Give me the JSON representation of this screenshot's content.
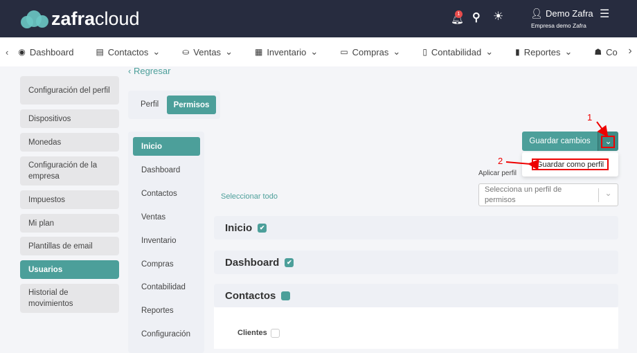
{
  "header": {
    "brand_bold": "zafra",
    "brand_light": "cloud",
    "notification_count": "1",
    "user_name": "Demo Zafra",
    "company": "Empresa demo Zafra"
  },
  "nav": {
    "items": [
      {
        "label": "Dashboard",
        "icon": "dashboard-icon"
      },
      {
        "label": "Contactos",
        "icon": "contact-card-icon",
        "dropdown": true
      },
      {
        "label": "Ventas",
        "icon": "hand-coin-icon",
        "dropdown": true
      },
      {
        "label": "Inventario",
        "icon": "boxes-icon",
        "dropdown": true
      },
      {
        "label": "Compras",
        "icon": "cart-icon",
        "dropdown": true
      },
      {
        "label": "Contabilidad",
        "icon": "calculator-icon",
        "dropdown": true
      },
      {
        "label": "Reportes",
        "icon": "bar-chart-icon",
        "dropdown": true
      },
      {
        "label": "Co",
        "icon": "burger-icon"
      }
    ]
  },
  "back_label": "Regresar",
  "sidebar": {
    "items": [
      "Configuración del perfil",
      "Dispositivos",
      "Monedas",
      "Configuración de la empresa",
      "Impuestos",
      "Mi plan",
      "Plantillas de email",
      "Usuarios",
      "Historial de movimientos"
    ],
    "active": "Usuarios"
  },
  "tabs": {
    "items": [
      "Perfil",
      "Permisos"
    ],
    "active": "Permisos"
  },
  "submenu": {
    "items": [
      "Inicio",
      "Dashboard",
      "Contactos",
      "Ventas",
      "Inventario",
      "Compras",
      "Contabilidad",
      "Reportes",
      "Configuración"
    ],
    "active": "Inicio"
  },
  "main": {
    "select_all": "Seleccionar todo",
    "save_label": "Guardar cambios",
    "dropdown_item": "Guardar como perfil",
    "apply_profile_label": "Aplicar perfil",
    "apply_profile_placeholder": "Selecciona un perfil de permisos",
    "sections": [
      {
        "title": "Inicio",
        "state": "checked"
      },
      {
        "title": "Dashboard",
        "state": "checked"
      },
      {
        "title": "Contactos",
        "state": "indeterminate"
      }
    ],
    "sub_items": [
      {
        "label": "Clientes",
        "checked": false
      }
    ]
  },
  "annotations": [
    "1",
    "2"
  ],
  "colors": {
    "header": "#272c3f",
    "accent": "#4c9f9a",
    "annotation": "#e00000"
  }
}
